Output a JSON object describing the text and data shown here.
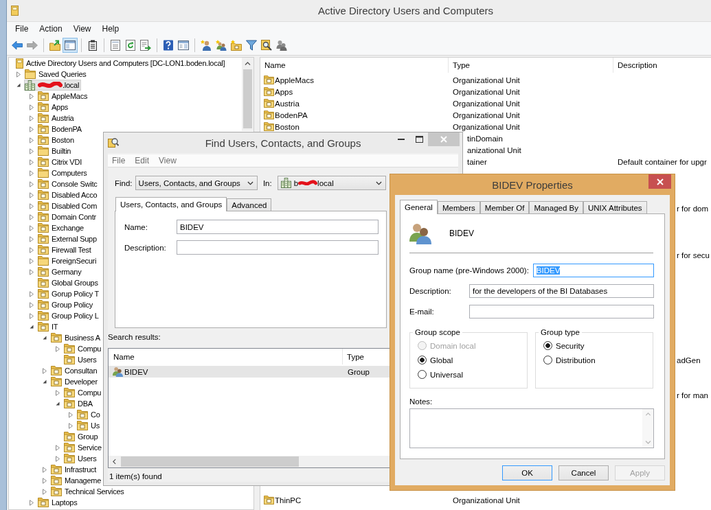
{
  "main_window": {
    "title": "Active Directory Users and Computers",
    "menu": [
      "File",
      "Action",
      "View",
      "Help"
    ],
    "toolbar": [
      {
        "kind": "button",
        "pressed": false,
        "disabled": false
      },
      {
        "kind": "button",
        "pressed": false,
        "disabled": true
      },
      {
        "kind": "separator"
      },
      {
        "kind": "button",
        "pressed": false,
        "disabled": false
      },
      {
        "kind": "button",
        "pressed": true,
        "disabled": false
      },
      {
        "kind": "separator"
      },
      {
        "kind": "button",
        "pressed": false,
        "disabled": false
      },
      {
        "kind": "separator"
      },
      {
        "kind": "button",
        "pressed": false,
        "disabled": false
      },
      {
        "kind": "button",
        "pressed": false,
        "disabled": false
      },
      {
        "kind": "button",
        "pressed": false,
        "disabled": false
      },
      {
        "kind": "separator"
      },
      {
        "kind": "button",
        "pressed": false,
        "disabled": false
      },
      {
        "kind": "button",
        "pressed": false,
        "disabled": false
      },
      {
        "kind": "separator"
      },
      {
        "kind": "button",
        "pressed": false,
        "disabled": false
      },
      {
        "kind": "button",
        "pressed": false,
        "disabled": false
      },
      {
        "kind": "button",
        "pressed": false,
        "disabled": false
      },
      {
        "kind": "button",
        "pressed": false,
        "disabled": false
      },
      {
        "kind": "button",
        "pressed": false,
        "disabled": false
      },
      {
        "kind": "button",
        "pressed": false,
        "disabled": false
      }
    ],
    "tree": [
      {
        "label": "Active Directory Users and Computers [DC-LON1.boden.local]",
        "kind": "snapin",
        "selected": false,
        "children": [
          {
            "label": "Saved Queries",
            "kind": "folder",
            "expanded": false,
            "selected": false
          },
          {
            "label": ".local",
            "kind": "domain",
            "redacted": true,
            "expanded": true,
            "selected": true,
            "children": [
              {
                "label": "AppleMacs",
                "kind": "ou",
                "expanded": false,
                "selected": false
              },
              {
                "label": "Apps",
                "kind": "ou",
                "expanded": false,
                "selected": false
              },
              {
                "label": "Austria",
                "kind": "ou",
                "expanded": false,
                "selected": false
              },
              {
                "label": "BodenPA",
                "kind": "ou",
                "expanded": false,
                "selected": false
              },
              {
                "label": "Boston",
                "kind": "ou",
                "expanded": false,
                "selected": false
              },
              {
                "label": "Builtin",
                "kind": "folder",
                "expanded": false,
                "selected": false
              },
              {
                "label": "Citrix VDI",
                "kind": "ou",
                "expanded": false,
                "selected": false
              },
              {
                "label": "Computers",
                "kind": "folder",
                "expanded": false,
                "selected": false
              },
              {
                "label": "Console Switc",
                "kind": "ou",
                "expanded": false,
                "selected": false
              },
              {
                "label": "Disabled Acco",
                "kind": "ou",
                "expanded": false,
                "selected": false
              },
              {
                "label": "Disabled Com",
                "kind": "ou",
                "expanded": false,
                "selected": false
              },
              {
                "label": "Domain Contr",
                "kind": "ou",
                "expanded": false,
                "selected": false
              },
              {
                "label": "Exchange",
                "kind": "ou",
                "expanded": false,
                "selected": false
              },
              {
                "label": "External Supp",
                "kind": "ou",
                "expanded": false,
                "selected": false
              },
              {
                "label": "Firewall Test",
                "kind": "ou",
                "expanded": false,
                "selected": false
              },
              {
                "label": "ForeignSecuri",
                "kind": "folder",
                "expanded": false,
                "selected": false
              },
              {
                "label": "Germany",
                "kind": "ou",
                "expanded": false,
                "selected": false
              },
              {
                "label": "Global Groups",
                "kind": "ou",
                "selected": false
              },
              {
                "label": "Gorup Policy T",
                "kind": "ou",
                "expanded": false,
                "selected": false
              },
              {
                "label": "Group Policy",
                "kind": "ou",
                "expanded": false,
                "selected": false
              },
              {
                "label": "Group Policy L",
                "kind": "ou",
                "expanded": false,
                "selected": false
              },
              {
                "label": "IT",
                "kind": "ou",
                "expanded": true,
                "selected": false,
                "children": [
                  {
                    "label": "Business A",
                    "kind": "ou",
                    "expanded": true,
                    "selected": false,
                    "children": [
                      {
                        "label": "Compu",
                        "kind": "ou",
                        "expanded": false,
                        "selected": false
                      },
                      {
                        "label": "Users",
                        "kind": "ou",
                        "selected": false
                      }
                    ]
                  },
                  {
                    "label": "Consultan",
                    "kind": "ou",
                    "expanded": false,
                    "selected": false
                  },
                  {
                    "label": "Developer",
                    "kind": "ou",
                    "expanded": true,
                    "selected": false,
                    "children": [
                      {
                        "label": "Compu",
                        "kind": "ou",
                        "expanded": false,
                        "selected": false
                      },
                      {
                        "label": "DBA",
                        "kind": "ou",
                        "expanded": true,
                        "selected": false,
                        "children": [
                          {
                            "label": "Co",
                            "kind": "ou",
                            "expanded": false,
                            "selected": false
                          },
                          {
                            "label": "Us",
                            "kind": "ou",
                            "expanded": false,
                            "selected": false
                          }
                        ]
                      },
                      {
                        "label": "Group",
                        "kind": "ou",
                        "selected": false
                      },
                      {
                        "label": "Service",
                        "kind": "ou",
                        "expanded": false,
                        "selected": false
                      },
                      {
                        "label": "Users",
                        "kind": "ou",
                        "expanded": false,
                        "selected": false
                      }
                    ]
                  },
                  {
                    "label": "Infrastruct",
                    "kind": "ou",
                    "expanded": false,
                    "selected": false
                  },
                  {
                    "label": "Manageme",
                    "kind": "ou",
                    "expanded": false,
                    "selected": false
                  },
                  {
                    "label": "Technical Services",
                    "kind": "ou",
                    "expanded": false,
                    "selected": false
                  }
                ]
              },
              {
                "label": "Laptops",
                "kind": "ou",
                "expanded": false,
                "selected": false
              }
            ]
          }
        ]
      }
    ],
    "list": {
      "columns": [
        "Name",
        "Type",
        "Description"
      ],
      "rows": [
        {
          "kind": "ou",
          "name": "AppleMacs",
          "type": "Organizational Unit"
        },
        {
          "kind": "ou",
          "name": "Apps",
          "type": "Organizational Unit"
        },
        {
          "kind": "ou",
          "name": "Austria",
          "type": "Organizational Unit"
        },
        {
          "kind": "ou",
          "name": "BodenPA",
          "type": "Organizational Unit"
        },
        {
          "kind": "ou",
          "name": "Boston",
          "type": "Organizational Unit"
        },
        {
          "kind": "name_covered",
          "type": "tinDomain"
        },
        {
          "kind": "name_covered",
          "type": "anizational Unit"
        },
        {
          "kind": "name_covered",
          "type": "tainer",
          "description": "Default container for upgr"
        },
        {
          "kind": "covered"
        },
        {
          "kind": "covered"
        },
        {
          "kind": "covered"
        },
        {
          "kind": "mostly_covered",
          "description": "r for dom"
        },
        {
          "kind": "covered"
        },
        {
          "kind": "covered"
        },
        {
          "kind": "covered"
        },
        {
          "kind": "mostly_covered",
          "description": "r for secu"
        },
        {
          "kind": "covered"
        },
        {
          "kind": "covered"
        },
        {
          "kind": "covered"
        },
        {
          "kind": "covered"
        },
        {
          "kind": "covered"
        },
        {
          "kind": "covered"
        },
        {
          "kind": "covered"
        },
        {
          "kind": "covered"
        },
        {
          "kind": "mostly_covered",
          "description": "adGen"
        },
        {
          "kind": "covered"
        },
        {
          "kind": "covered"
        },
        {
          "kind": "mostly_covered",
          "description": "r for man"
        },
        {
          "kind": "covered"
        },
        {
          "kind": "covered"
        },
        {
          "kind": "covered"
        },
        {
          "kind": "covered"
        },
        {
          "kind": "covered"
        },
        {
          "kind": "covered"
        },
        {
          "kind": "covered"
        },
        {
          "kind": "covered"
        },
        {
          "kind": "ou",
          "name": "ThinPC",
          "type": "Organizational Unit"
        }
      ]
    }
  },
  "find_dialog": {
    "title": "Find Users, Contacts, and Groups",
    "menu": [
      "File",
      "Edit",
      "View"
    ],
    "find": {
      "label": "Find:",
      "value": "Users, Contacts, and Groups"
    },
    "in": {
      "label": "In:",
      "value_start": "b",
      "value_end": "local",
      "redacted": true
    },
    "tabs": [
      {
        "label": "Users, Contacts, and Groups",
        "selected": true
      },
      {
        "label": "Advanced",
        "selected": false
      }
    ],
    "fields": [
      {
        "label": "Name:",
        "value": "BIDEV"
      },
      {
        "label": "Description:"
      }
    ],
    "results_label": "Search results:",
    "results": {
      "columns": [
        "Name",
        "Type"
      ],
      "rows": [
        {
          "name": "BIDEV",
          "type": "Group",
          "selected": true
        }
      ]
    },
    "status": "1 item(s) found"
  },
  "properties_dialog": {
    "title": "BIDEV Properties",
    "tabs": [
      {
        "label": "General",
        "selected": true
      },
      {
        "label": "Members",
        "selected": false
      },
      {
        "label": "Member Of",
        "selected": false
      },
      {
        "label": "Managed By",
        "selected": false
      },
      {
        "label": "UNIX Attributes",
        "selected": false
      }
    ],
    "object_name": "BIDEV",
    "fields": [
      {
        "label": "Group name (pre-Windows 2000):",
        "value": "BIDEV",
        "focused": true
      },
      {
        "label": "Description:",
        "value": "for the developers of the BI Databases",
        "focused": false
      },
      {
        "label": "E-mail:",
        "focused": false
      }
    ],
    "group_scope": {
      "title": "Group scope",
      "options": [
        {
          "label": "Domain local",
          "selected": false,
          "disabled": true
        },
        {
          "label": "Global",
          "selected": true,
          "disabled": false
        },
        {
          "label": "Universal",
          "selected": false,
          "disabled": false
        }
      ]
    },
    "group_type": {
      "title": "Group type",
      "options": [
        {
          "label": "Security",
          "selected": true,
          "disabled": false
        },
        {
          "label": "Distribution",
          "selected": false,
          "disabled": false
        }
      ]
    },
    "notes": {
      "label": "Notes:"
    },
    "buttons": [
      {
        "label": "OK",
        "default": true,
        "disabled": false
      },
      {
        "label": "Cancel",
        "default": false,
        "disabled": false
      },
      {
        "label": "Apply",
        "default": false,
        "disabled": true
      }
    ]
  }
}
